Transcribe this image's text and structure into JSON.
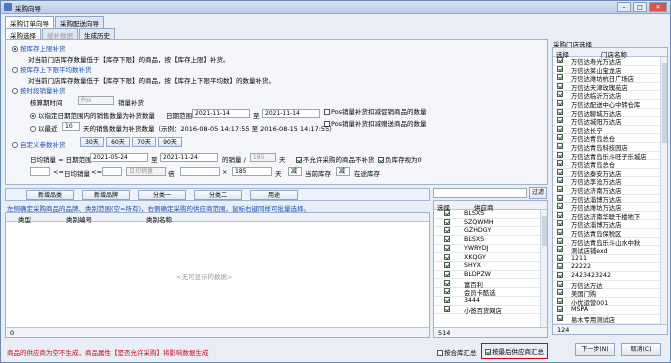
{
  "window": {
    "title": "采购向导",
    "close": "✕",
    "min": "–",
    "max": "□"
  },
  "tabs": [
    "采购订单向导",
    "采购配送向导"
  ],
  "subtabs": [
    "采购选择",
    "缓补数据",
    "生成历史"
  ],
  "options": {
    "o1_title": "按库存上限补货",
    "o1_desc": "对当前门店库存数量低于【库存下限】的商品，按【库存上限】补货。",
    "o2_title": "按库存上下限平均数补货",
    "o2_desc": "对当前门店库存数量低于【库存下限】的商品，按【库存上下限平均数】的数量补货。",
    "o3_title": "按时段销量补货",
    "period_label": "核算期时间",
    "period_val": "Pos",
    "sales_label": "销量补货",
    "r1_text": "以指定日期范围内的销售数量为补货数量",
    "date_range_label": "日期范围",
    "d1": "2021-11-14",
    "to": "至",
    "d2": "2021-11-14",
    "pos1": "Pos销量补货扣减促销商品的数量",
    "pos2": "Pos销量补货扣减赠送商品的数量",
    "r2_pre": "以最近",
    "r2_n": "10",
    "r2_text": "天的销售数量为补货数量（示例：2016-08-05 14:17:55 至 2016-08-15 14:17:55）",
    "o4_title": "自定义参数补货",
    "q": [
      "30天",
      "60天",
      "70天",
      "90天"
    ],
    "daily_label": "日均销量 = 日期范围",
    "d3": "2021-05-24",
    "d4": "2021-11-24",
    "dv_label": "的销量 /",
    "dv": "185",
    "days": "天",
    "no_sale": "不允许采购的商品不补货",
    "neg": "负库存视为0",
    "dl_label": "日均销量",
    "lt": "<=",
    "dl": "日均销量",
    "dl2": "日均销量",
    "x": "倍",
    "mul": "185",
    "days2": "天",
    "minus": "减",
    "cur_stock": "当前库存",
    "minus2": "减",
    "stock_label": "在途库存"
  },
  "toolbar": [
    "新增品类",
    "新增品牌",
    "分类一",
    "分类二",
    "用途"
  ],
  "hint": "左侧确定采购商品的品牌、类别范围(空=所有)，右侧确定采购的供应商范围，鼠标右键同样可批量选择。",
  "left_grid": {
    "headers": [
      "类型",
      "类别编号",
      "类别名称"
    ],
    "empty": "<无可显示的数据>",
    "count": "0"
  },
  "supplier": {
    "search_btn": "过滤",
    "headers": [
      "选择",
      "供应商"
    ],
    "rows": [
      "BLSXS",
      "SZQWMH",
      "GZHDGY",
      "BLSXS",
      "YWRYDJ",
      "XKQGY",
      "SHYX",
      "BLDPZW",
      "富百利",
      "会员卡酷选",
      "3444",
      "小爸百货网店"
    ],
    "count": "514"
  },
  "store": {
    "label": "采购门店选择",
    "headers": [
      "选择",
      "门店名称"
    ],
    "rows": [
      "万信达寿光万达店",
      "万信达莱山宝龙店",
      "万信达潍坊杭日广场店",
      "万信达天津玫瑰苑店",
      "万信达临沂万达店",
      "万信达配送中心中转仓库",
      "万信达聊城万达店",
      "万信达城阳万达店",
      "万信达长宁",
      "万信达青岛总仓",
      "万信达青岛科技园店",
      "万信达青岛乐斗旺子乐城店",
      "万信达青岛总仓",
      "万信达泰安万达店",
      "万信达李沧万达店",
      "万信达济南万达店",
      "万信达淄博万达店",
      "万信达潍坊万达店",
      "万信达济南华联千楼地下",
      "万信达淄博万达店",
      "万信达青岛保税区",
      "万信达青岛乐斗山水中秋",
      "测试店铺exd",
      "1211",
      "22222",
      "2423423242",
      "万信达万达",
      "美国门购",
      "小优运营001",
      "MSPA",
      "易木专用测试店"
    ],
    "count": "124"
  },
  "status": "商品的供应商为空不生成，商品属性【是否允许采购】将影响数据生成",
  "bottom": {
    "c1": "按合库汇总",
    "c2": "按最后供应商汇总",
    "next": "下一步(N)",
    "cancel": "取消(C)"
  }
}
